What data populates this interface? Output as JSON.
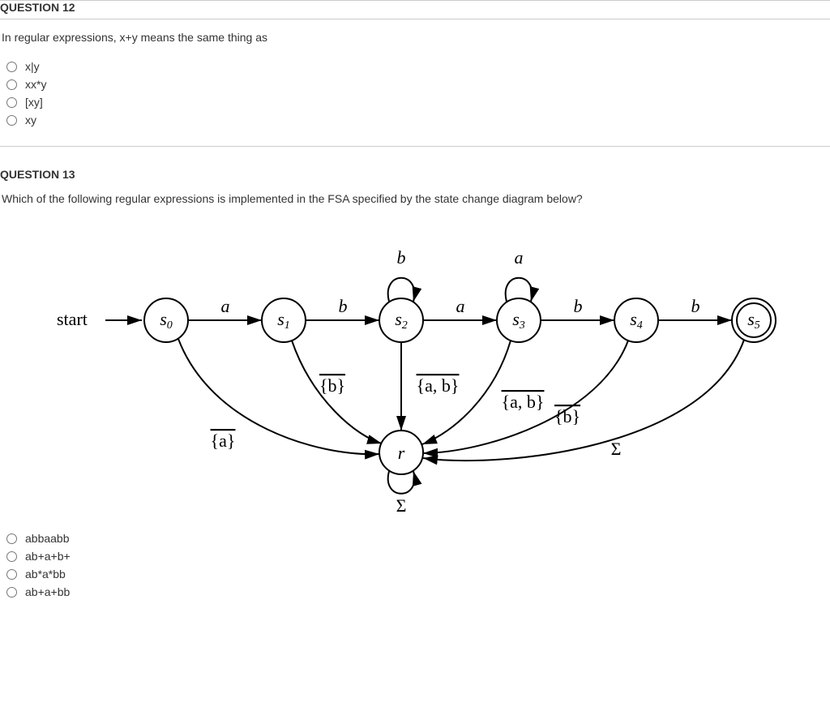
{
  "q12": {
    "header": "QUESTION 12",
    "text": "In regular expressions, x+y means the same thing as",
    "options": [
      "x|y",
      "xx*y",
      "[xy]",
      "xy"
    ]
  },
  "q13": {
    "header": "QUESTION 13",
    "text": "Which of the following regular expressions is implemented in the FSA specified by the state change diagram below?",
    "options": [
      "abbaabb",
      "ab+a+b+",
      "ab*a*bb",
      "ab+a+bb"
    ]
  },
  "fsa": {
    "start": "start",
    "states": [
      "s0",
      "s1",
      "s2",
      "s3",
      "s4",
      "s5",
      "r"
    ],
    "s_prefix": "s",
    "r_label": "r",
    "trans": {
      "a": "a",
      "b": "b",
      "not_a": "{a}",
      "not_b": "{b}",
      "not_ab": "{a, b}",
      "sigma": "Σ"
    }
  }
}
